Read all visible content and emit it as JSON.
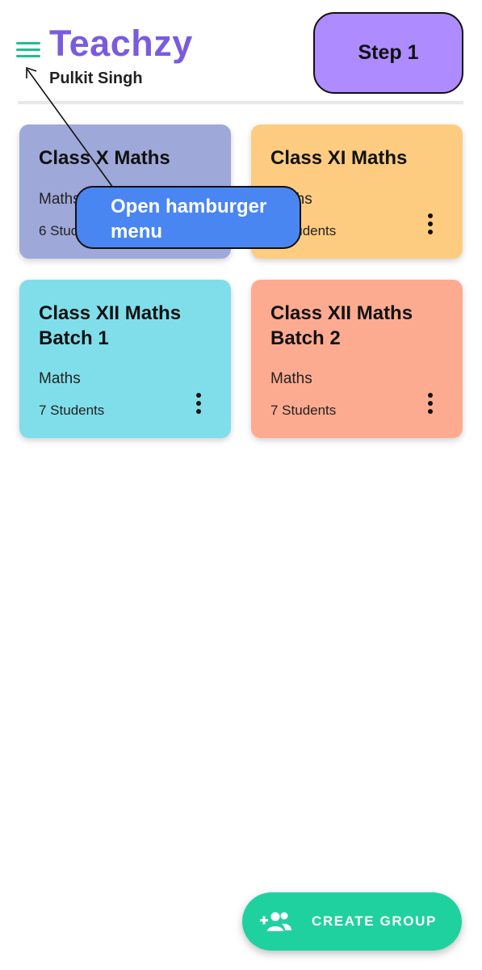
{
  "header": {
    "app_title": "Teachzy",
    "user_name": "Pulkit Singh"
  },
  "step_badge": "Step 1",
  "callout": "Open hamburger menu",
  "groups": [
    {
      "title": "Class X Maths",
      "subject": "Maths",
      "count": "6 Students",
      "color": "#9ea8d9"
    },
    {
      "title": "Class XI Maths",
      "subject": "Maths",
      "count": "7 Students",
      "color": "#fecc80"
    },
    {
      "title": "Class XII Maths Batch 1",
      "subject": "Maths",
      "count": "7 Students",
      "color": "#80deea"
    },
    {
      "title": "Class XII Maths Batch 2",
      "subject": "Maths",
      "count": "7 Students",
      "color": "#fdab90"
    }
  ],
  "fab": {
    "label": "CREATE GROUP",
    "icon": "add-group-icon"
  },
  "colors": {
    "brand": "#7a5be0",
    "accent": "#20d1a0",
    "callout": "#4a86f2",
    "step_badge": "#ae8bff"
  }
}
